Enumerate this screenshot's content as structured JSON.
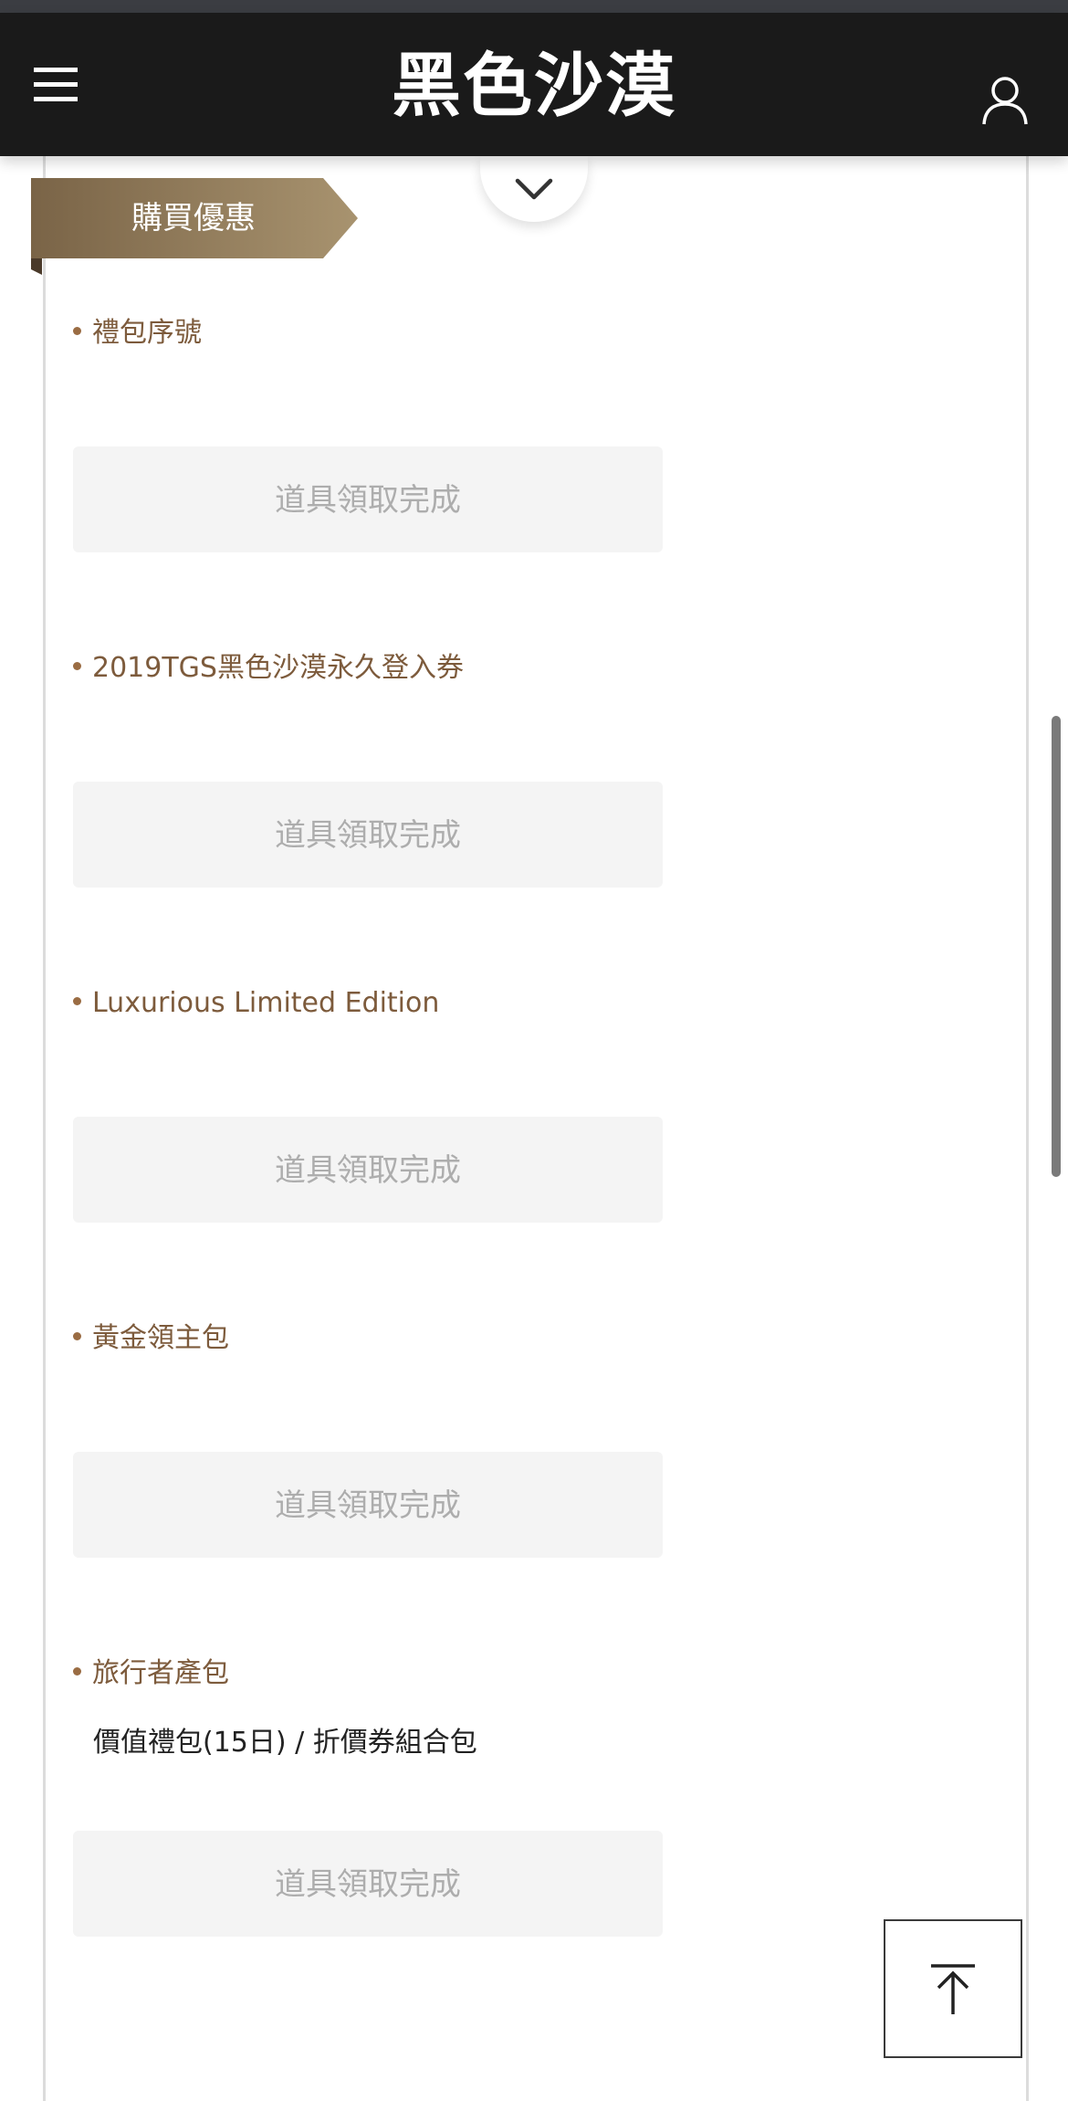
{
  "header": {
    "logo_text": "黑色沙漠",
    "menu_icon": "hamburger-menu-icon",
    "user_icon": "user-account-icon"
  },
  "section": {
    "ribbon_label": "購買優惠",
    "toggle_icon": "chevron-down-icon"
  },
  "items": [
    {
      "title": "禮包序號",
      "description": "",
      "button_label": "道具領取完成"
    },
    {
      "title": "2019TGS黑色沙漠永久登入券",
      "description": "",
      "button_label": "道具領取完成"
    },
    {
      "title": "Luxurious Limited Edition",
      "description": "",
      "button_label": "道具領取完成"
    },
    {
      "title": "黃金領主包",
      "description": "",
      "button_label": "道具領取完成"
    },
    {
      "title": "旅行者產包",
      "description": "價值禮包(15日) / 折價券組合包",
      "button_label": "道具領取完成"
    }
  ],
  "back_to_top_icon": "arrow-up-to-top-icon",
  "colors": {
    "header_bg": "#1a1a1a",
    "accent_brown": "#7d5b3c",
    "ribbon_gold": "#a08a68",
    "button_bg": "#f4f4f4",
    "button_text": "#adadad"
  }
}
